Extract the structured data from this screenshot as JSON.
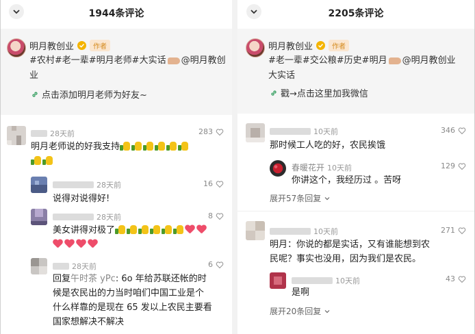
{
  "left": {
    "header": {
      "count_title": "1944条评论"
    },
    "author": {
      "name": "明月教创业",
      "badge": "作者",
      "hashtags_line1": "#农村#老一辈#明月老师#大实话",
      "hashtags_mention": "@明月教创",
      "hashtags_line2": "业",
      "link_text": "点击添加明月老师为好友~"
    },
    "comments": [
      {
        "time": "28天前",
        "likes": "283",
        "text": "明月老师说的好我支持",
        "emoji": "thumbs-up x8"
      },
      {
        "time": "28天前",
        "likes": "16",
        "text": "说得对说得好!"
      },
      {
        "time": "28天前",
        "likes": "8",
        "text": "美女讲得对极了",
        "emoji": "thumbs-up x6, heart x6"
      },
      {
        "time": "28天前",
        "likes": "6",
        "reply_prefix": "回复",
        "reply_to": "午时茶 yPc",
        "text_1": ": 6o 年给苏联还帐的时",
        "text_2": "候是农民出的力当时咱们中国工业是个",
        "text_3": "什么样靠的是现在 65 发以上农民主要看",
        "text_4": "国家想解决不解决"
      }
    ]
  },
  "right": {
    "header": {
      "count_title": "2205条评论"
    },
    "author": {
      "name": "明月教创业",
      "badge": "作者",
      "hashtags_line1": "#老一辈#交公粮#历史#明月",
      "hashtags_mention": "@明月教创业",
      "hashtags_line2": "大实话",
      "link_text": "戳→点击这里加我微信"
    },
    "comments": [
      {
        "time": "10天前",
        "likes": "346",
        "text": "那时候工人吃的好，农民挨饿"
      },
      {
        "name": "春暖花开",
        "time": "10天前",
        "likes": "129",
        "text": "你讲这个，我经历过 。苦呀"
      },
      {
        "expand_label": "展开57条回复"
      },
      {
        "time": "10天前",
        "likes": "271",
        "text_1": "明月：你说的都是实话，又有谁能想到农",
        "text_2": "民呢？事实也没用，因为我们是农民。"
      },
      {
        "time": "10天前",
        "likes": "43",
        "text": "是啊"
      },
      {
        "expand_label": "展开20条回复"
      }
    ]
  },
  "colors": {
    "badge_text": "#d48a1e",
    "badge_bg": "#fbe6cf",
    "heart": "#ee4d6a",
    "verify": "#f4b400",
    "card_bg": "#f5f5f5"
  },
  "icons": [
    "chevron-down-icon",
    "verified-icon",
    "link-icon",
    "heart-outline-icon",
    "chevron-down-small-icon"
  ]
}
